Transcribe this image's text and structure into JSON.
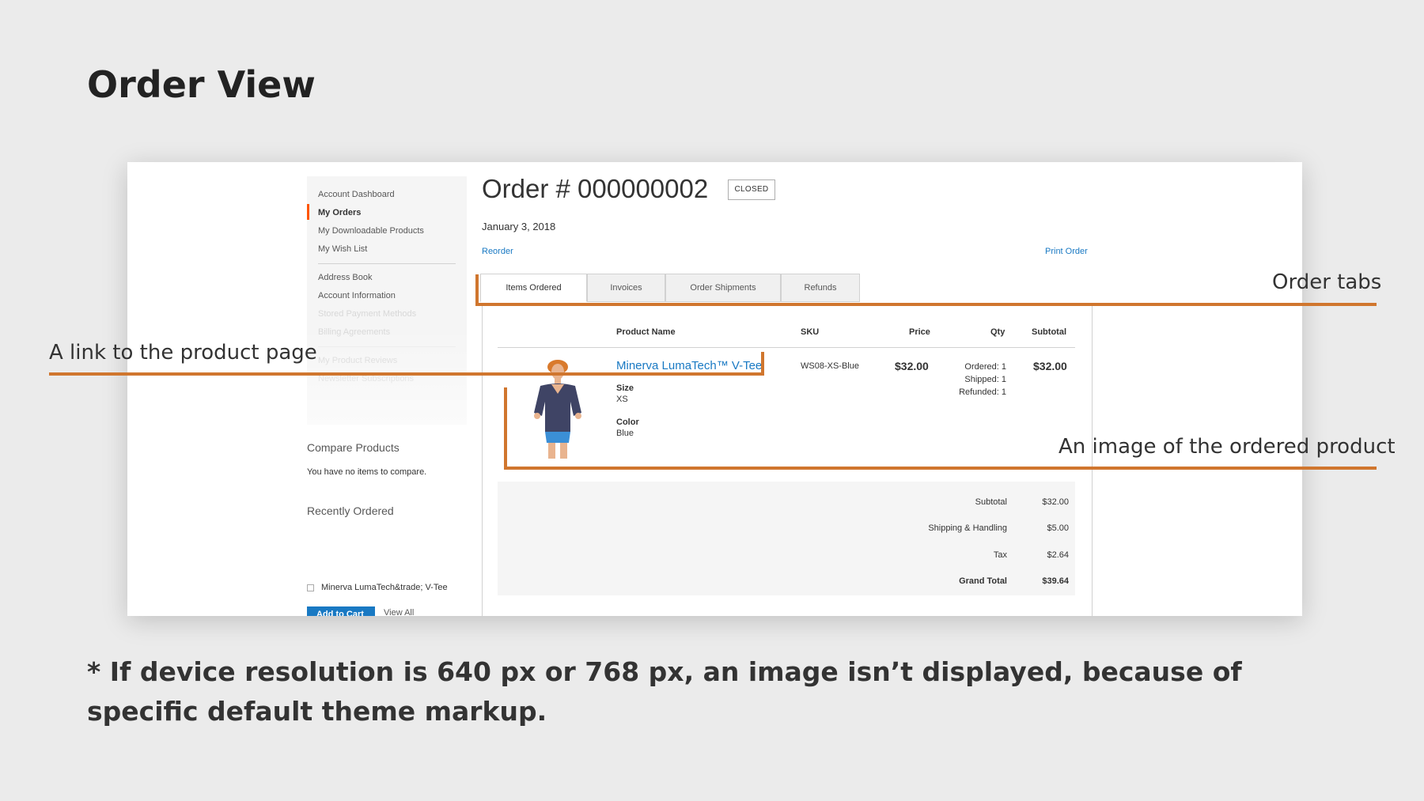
{
  "slide": {
    "title": "Order View",
    "footnote": "* If device resolution is 640 px or 768 px, an image isn’t displayed, because of specific default theme markup."
  },
  "annotations": {
    "order_tabs": "Order tabs",
    "product_link": "A link to the product page",
    "product_image": "An image of the ordered product",
    "line_color": "#d0762e"
  },
  "sidebar": {
    "nav": [
      {
        "label": "Account Dashboard"
      },
      {
        "label": "My Orders",
        "active": true
      },
      {
        "label": "My Downloadable Products"
      },
      {
        "label": "My Wish List"
      },
      {
        "label": "Address Book"
      },
      {
        "label": "Account Information"
      },
      {
        "label": "Stored Payment Methods"
      },
      {
        "label": "Billing Agreements"
      },
      {
        "label": "My Product Reviews"
      },
      {
        "label": "Newsletter Subscriptions"
      }
    ],
    "active_color": "#ff5501",
    "compare": {
      "heading": "Compare Products",
      "empty_text": "You have no items to compare."
    },
    "recent": {
      "heading": "Recently Ordered",
      "item": "Minerva LumaTech&trade; V-Tee",
      "add_to_cart": "Add to Cart",
      "view_all": "View All"
    }
  },
  "order": {
    "title": "Order # 000000002",
    "status": "CLOSED",
    "date": "January 3, 2018",
    "reorder": "Reorder",
    "print": "Print Order",
    "tabs": [
      {
        "label": "Items Ordered",
        "active": true
      },
      {
        "label": "Invoices"
      },
      {
        "label": "Order Shipments"
      },
      {
        "label": "Refunds"
      }
    ],
    "table": {
      "headers": {
        "name": "Product Name",
        "sku": "SKU",
        "price": "Price",
        "qty": "Qty",
        "subtotal": "Subtotal"
      },
      "item": {
        "name": "Minerva LumaTech™ V-Tee",
        "options": [
          {
            "label": "Size",
            "value": "XS"
          },
          {
            "label": "Color",
            "value": "Blue"
          }
        ],
        "sku": "WS08-XS-Blue",
        "price": "$32.00",
        "qty": [
          "Ordered: 1",
          "Shipped: 1",
          "Refunded: 1"
        ],
        "subtotal": "$32.00"
      }
    },
    "totals": [
      {
        "label": "Subtotal",
        "value": "$32.00"
      },
      {
        "label": "Shipping & Handling",
        "value": "$5.00"
      },
      {
        "label": "Tax",
        "value": "$2.64"
      },
      {
        "label": "Grand Total",
        "value": "$39.64"
      }
    ],
    "link_color": "#1979c3"
  }
}
